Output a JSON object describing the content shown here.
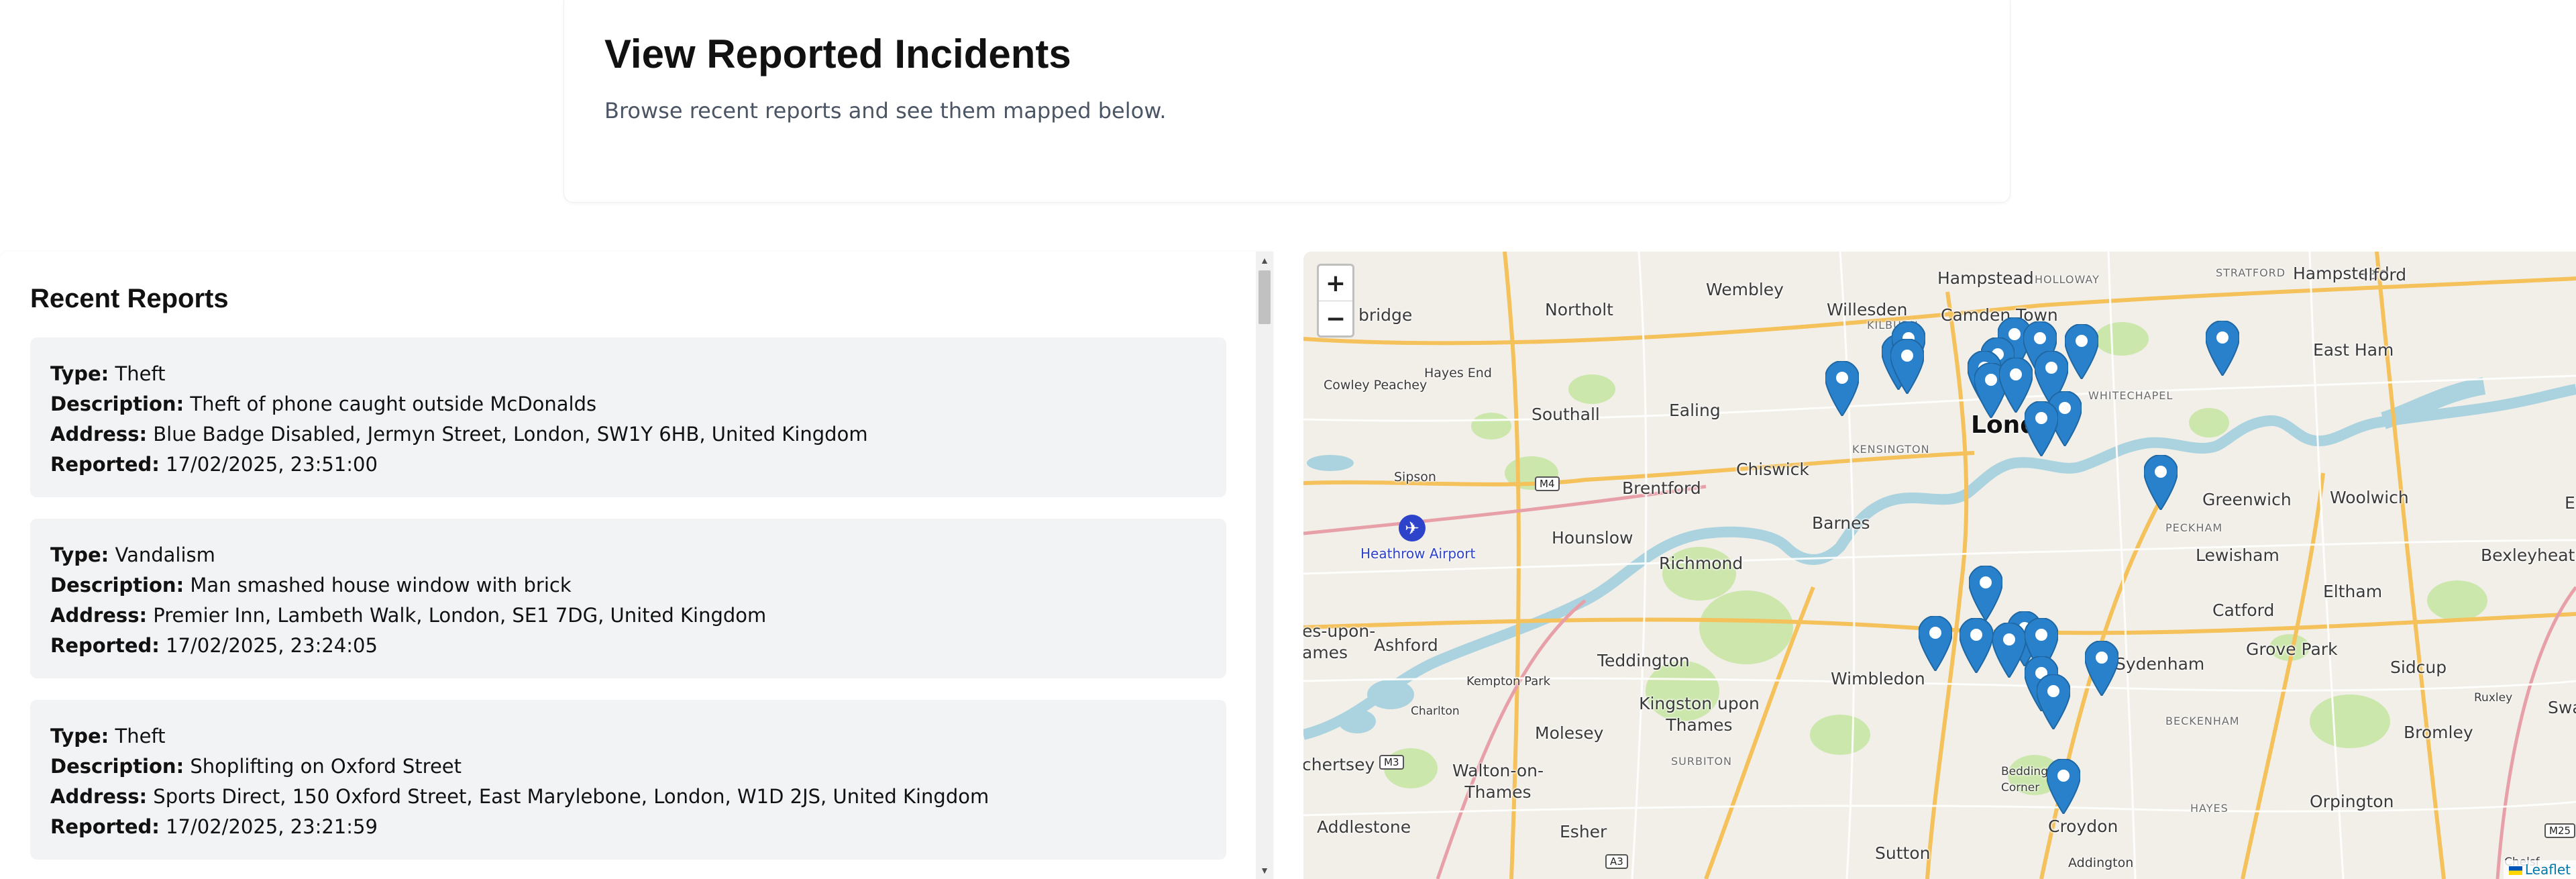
{
  "header": {
    "title": "View Reported Incidents",
    "subtitle": "Browse recent reports and see them mapped below."
  },
  "reports": {
    "heading": "Recent Reports",
    "labels": {
      "type": "Type:",
      "description": "Description:",
      "address": "Address:",
      "reported": "Reported:"
    },
    "items": [
      {
        "type": "Theft",
        "description": "Theft of phone caught outside McDonalds",
        "address": "Blue Badge Disabled, Jermyn Street, London, SW1Y 6HB, United Kingdom",
        "reported": "17/02/2025, 23:51:00"
      },
      {
        "type": "Vandalism",
        "description": "Man smashed house window with brick",
        "address": "Premier Inn, Lambeth Walk, London, SE1 7DG, United Kingdom",
        "reported": "17/02/2025, 23:24:05"
      },
      {
        "type": "Theft",
        "description": "Shoplifting on Oxford Street",
        "address": "Sports Direct, 150 Oxford Street, East Marylebone, London, W1D 2JS, United Kingdom",
        "reported": "17/02/2025, 23:21:59"
      }
    ]
  },
  "map": {
    "zoom_in": "+",
    "zoom_out": "−",
    "attribution": "Leaflet",
    "city_label": "Lond",
    "airport_label": "Heathrow Airport",
    "places": [
      "Hampstead",
      "Wembley",
      "Willesden",
      "Camden Town",
      "Ilford",
      "East Ham",
      "Northolt",
      "Cowley Peachey",
      "Hayes End",
      "Southall",
      "Ealing",
      "Chiswick",
      "Brentford",
      "Sipson",
      "Hounslow",
      "Barnes",
      "Richmond",
      "Greenwich",
      "Woolwich",
      "Lewisham",
      "Bexleyheath",
      "Eltham",
      "Catford",
      "Sydenham",
      "Grove Park",
      "Sidcup",
      "Wimbledon",
      "Teddington",
      "Ashford",
      "Kempton Park",
      "Charlton",
      "Kingston upon Thames",
      "Molesey",
      "Walton-on-Thames",
      "Surbiton",
      "Beddington Corner",
      "Bromley",
      "Swan",
      "Orpington",
      "Croydon",
      "Hayes",
      "Addlestone",
      "Esher",
      "Sutton",
      "Addington",
      "Chelsf",
      "Ruxley",
      "bridge",
      "es-upon-ames",
      "chertsey",
      "Er"
    ],
    "small_places": [
      "KILBURN",
      "HOLLOWAY",
      "STRATFORD",
      "WHITECHAPEL",
      "KENSINGTON",
      "PECKHAM",
      "BECKENHAM",
      "SURBITON",
      "HAYES"
    ],
    "road_shields": [
      "M4",
      "M3",
      "A3",
      "M25"
    ]
  },
  "colors": {
    "marker": "#2a81cb",
    "water": "#aad3df",
    "park": "#c8e6a5"
  }
}
